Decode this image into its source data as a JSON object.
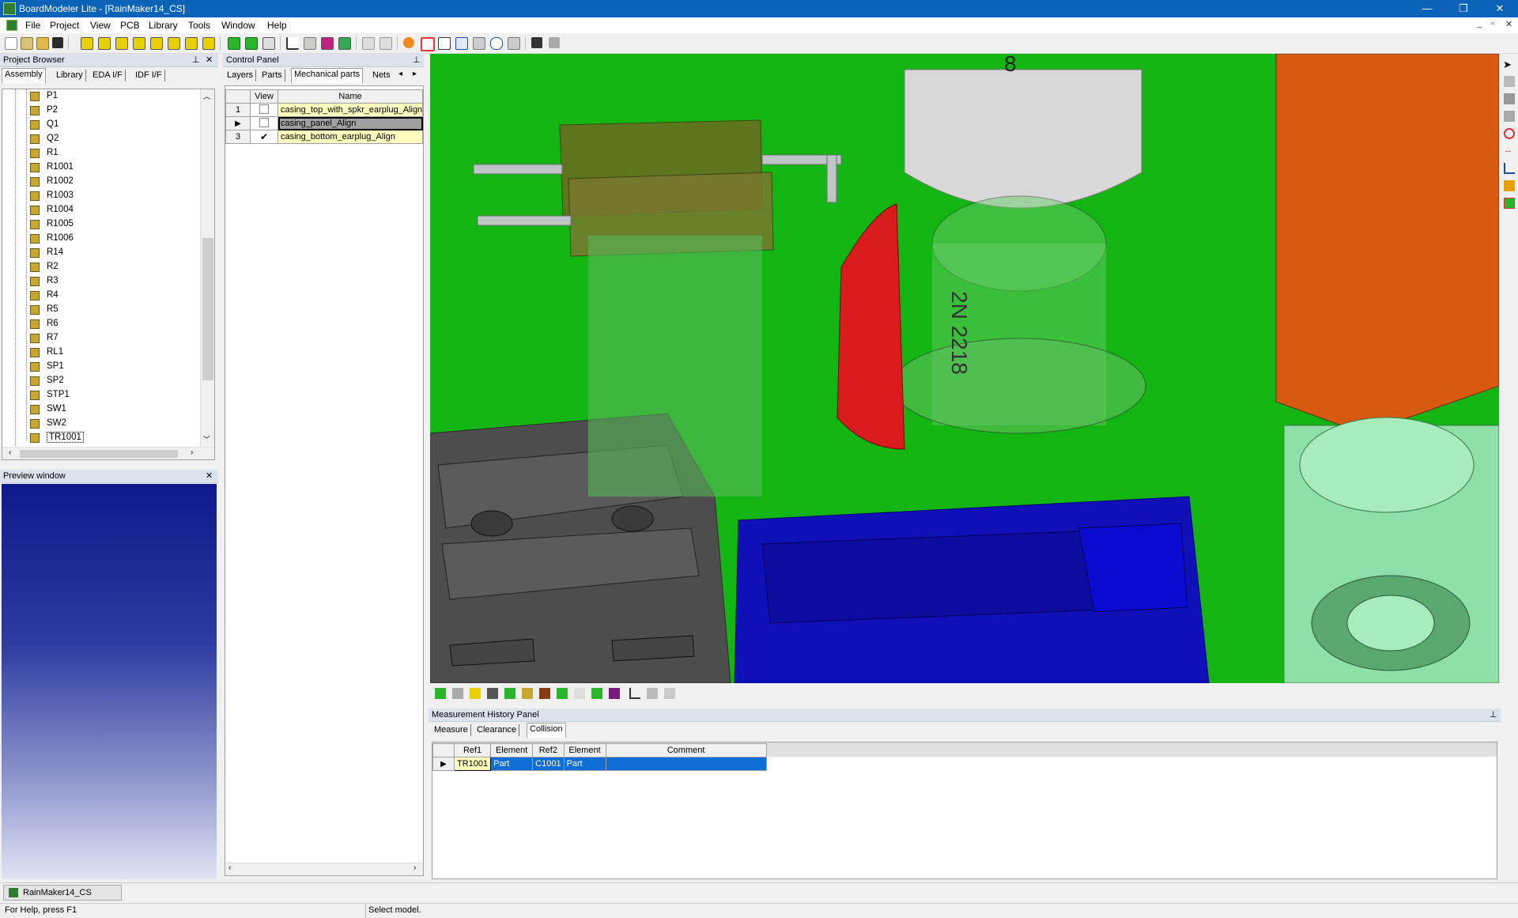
{
  "window": {
    "title": "BoardModeler Lite - [RainMaker14_CS]",
    "minimize": "—",
    "restore": "❐",
    "close": "✕"
  },
  "menu": [
    "File",
    "Project",
    "View",
    "PCB",
    "Library",
    "Tools",
    "Window",
    "Help"
  ],
  "mdi_controls": [
    "_",
    "▫",
    "✕"
  ],
  "project_browser": {
    "title": "Project Browser",
    "tabs": [
      "Assembly",
      "Library",
      "EDA I/F",
      "IDF I/F"
    ],
    "items": [
      "P1",
      "P2",
      "Q1",
      "Q2",
      "R1",
      "R1001",
      "R1002",
      "R1003",
      "R1004",
      "R1005",
      "R1006",
      "R14",
      "R2",
      "R3",
      "R4",
      "R5",
      "R6",
      "R7",
      "RL1",
      "SP1",
      "SP2",
      "STP1",
      "SW1",
      "SW2",
      "TR1001"
    ]
  },
  "preview": {
    "title": "Preview window"
  },
  "control_panel": {
    "title": "Control Panel",
    "tabs": [
      "Layers",
      "Parts",
      "Mechanical parts",
      "Nets"
    ],
    "columns": [
      "View",
      "Name"
    ],
    "rows": [
      {
        "num": "1",
        "checked": false,
        "name": "casing_top_with_spkr_earplug_Align"
      },
      {
        "num": "",
        "checked": false,
        "name": "casing_panel_Align"
      },
      {
        "num": "3",
        "checked": true,
        "name": "casing_bottom_earplug_Align"
      }
    ]
  },
  "viewport_labels": {
    "cap_top": "8",
    "transistor": "2N 2218"
  },
  "measurement": {
    "title": "Measurement History Panel",
    "tabs": [
      "Measure",
      "Clearance",
      "Collision"
    ],
    "columns": [
      "Ref1",
      "Element",
      "Ref2",
      "Element",
      "Comment"
    ],
    "rows": [
      {
        "ref1": "TR1001",
        "el1": "Part",
        "ref2": "C1001",
        "el2": "Part",
        "comment": ""
      }
    ]
  },
  "taskbar": {
    "doc": "RainMaker14_CS"
  },
  "status": {
    "help": "For Help, press F1",
    "msg": "Select model."
  },
  "colors": {
    "titlebar": "#0b63b8",
    "board": "#12b512",
    "selection": "#0f6fd6",
    "highlight": "#ffffc0"
  }
}
